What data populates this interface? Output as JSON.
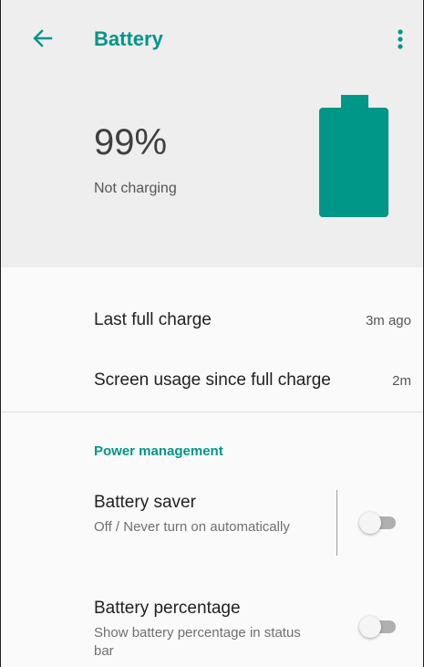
{
  "header": {
    "title": "Battery",
    "back_icon": "arrow-back-icon",
    "more_icon": "more-vert-icon",
    "accent_color": "#009688"
  },
  "status": {
    "percentage": "99%",
    "charging_state": "Not charging",
    "battery_icon": "battery-full-icon",
    "battery_color": "#009688"
  },
  "usage": {
    "last_full_charge": {
      "label": "Last full charge",
      "value": "3m ago"
    },
    "screen_usage": {
      "label": "Screen usage since full charge",
      "value": "2m"
    }
  },
  "power_management": {
    "section_title": "Power management",
    "battery_saver": {
      "title": "Battery saver",
      "summary": "Off / Never turn on automatically",
      "enabled": false
    },
    "battery_percentage": {
      "title": "Battery percentage",
      "summary": "Show battery percentage in status bar",
      "enabled": false
    }
  }
}
